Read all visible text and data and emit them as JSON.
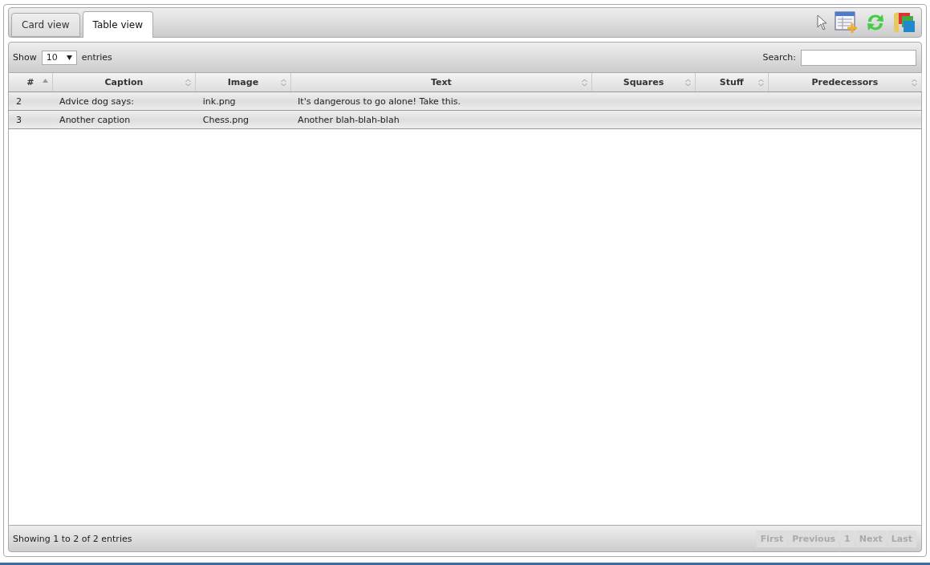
{
  "tabs": [
    {
      "label": "Card view",
      "selected": false
    },
    {
      "label": "Table view",
      "selected": true
    }
  ],
  "length_menu": {
    "before": "Show",
    "value": "10",
    "after": "entries"
  },
  "search": {
    "label": "Search:"
  },
  "table": {
    "columns": [
      {
        "label": "#",
        "sorted": true
      },
      {
        "label": "Caption",
        "sorted": false
      },
      {
        "label": "Image",
        "sorted": false
      },
      {
        "label": "Text",
        "sorted": false
      },
      {
        "label": "Squares",
        "sorted": false
      },
      {
        "label": "Stuff",
        "sorted": false
      },
      {
        "label": "Predecessors",
        "sorted": false
      }
    ],
    "rows": [
      [
        "2",
        "Advice dog says:",
        "ink.png",
        "It's dangerous to go alone! Take this.",
        "",
        "",
        ""
      ],
      [
        "3",
        "Another caption",
        "Chess.png",
        "Another blah-blah-blah",
        "",
        "",
        ""
      ]
    ]
  },
  "info": "Showing 1 to 2 of 2 entries",
  "pager": [
    {
      "label": "First",
      "disabled": true
    },
    {
      "label": "Previous",
      "disabled": true
    },
    {
      "label": "1",
      "disabled": true
    },
    {
      "label": "Next",
      "disabled": true
    },
    {
      "label": "Last",
      "disabled": true
    }
  ]
}
